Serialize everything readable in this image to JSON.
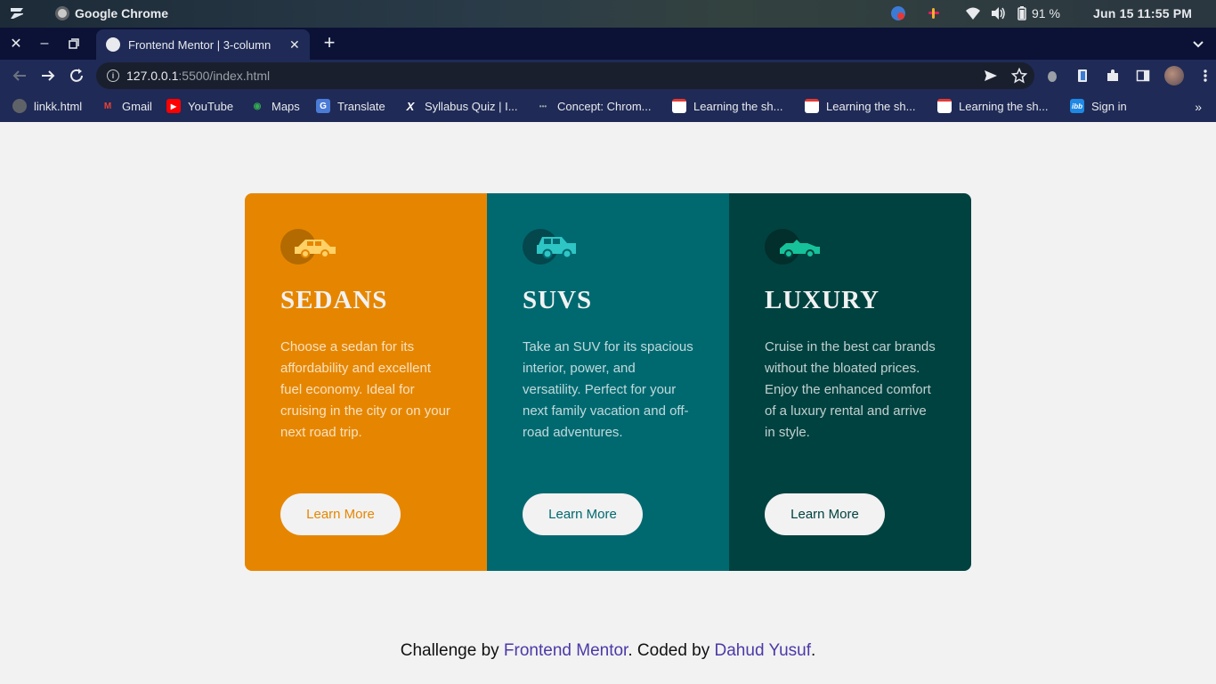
{
  "os": {
    "app_name": "Google Chrome",
    "battery": "91 %",
    "datetime": "Jun 15  11:55 PM"
  },
  "browser": {
    "tab_title": "Frontend Mentor | 3-column",
    "url_host": "127.0.0.1",
    "url_rest": ":5500/index.html",
    "bookmarks": [
      {
        "label": "linkk.html",
        "icon": "globe-icon"
      },
      {
        "label": "Gmail",
        "icon": "gmail-icon"
      },
      {
        "label": "YouTube",
        "icon": "youtube-icon"
      },
      {
        "label": "Maps",
        "icon": "maps-icon"
      },
      {
        "label": "Translate",
        "icon": "translate-icon"
      },
      {
        "label": "Syllabus Quiz | I...",
        "icon": "x-icon"
      },
      {
        "label": "Concept: Chrom...",
        "icon": "concept-icon"
      },
      {
        "label": "Learning the sh...",
        "icon": "document-icon"
      },
      {
        "label": "Learning the sh...",
        "icon": "document-icon"
      },
      {
        "label": "Learning the sh...",
        "icon": "document-icon"
      },
      {
        "label": "Sign in",
        "icon": "ibb-icon"
      }
    ]
  },
  "cards": [
    {
      "title": "SEDANS",
      "text": "Choose a sedan for its affordability and excellent fuel economy. Ideal for cruising in the city or on your next road trip.",
      "button": "Learn More",
      "icon": "sedan-car-icon",
      "color": "#e68600"
    },
    {
      "title": "SUVS",
      "text": "Take an SUV for its spacious interior, power, and versatility. Perfect for your next family vacation and off-road adventures.",
      "button": "Learn More",
      "icon": "suv-car-icon",
      "color": "#006970"
    },
    {
      "title": "LUXURY",
      "text": "Cruise in the best car brands without the bloated prices. Enjoy the enhanced comfort of a luxury rental and arrive in style.",
      "button": "Learn More",
      "icon": "luxury-car-icon",
      "color": "#004240"
    }
  ],
  "attribution": {
    "prefix": "Challenge by ",
    "link1": "Frontend Mentor",
    "middle": ". Coded by ",
    "link2": "Dahud Yusuf",
    "suffix": "."
  },
  "colors": {
    "page_bg": "#f2f2f2",
    "link": "#4a3aa8"
  }
}
